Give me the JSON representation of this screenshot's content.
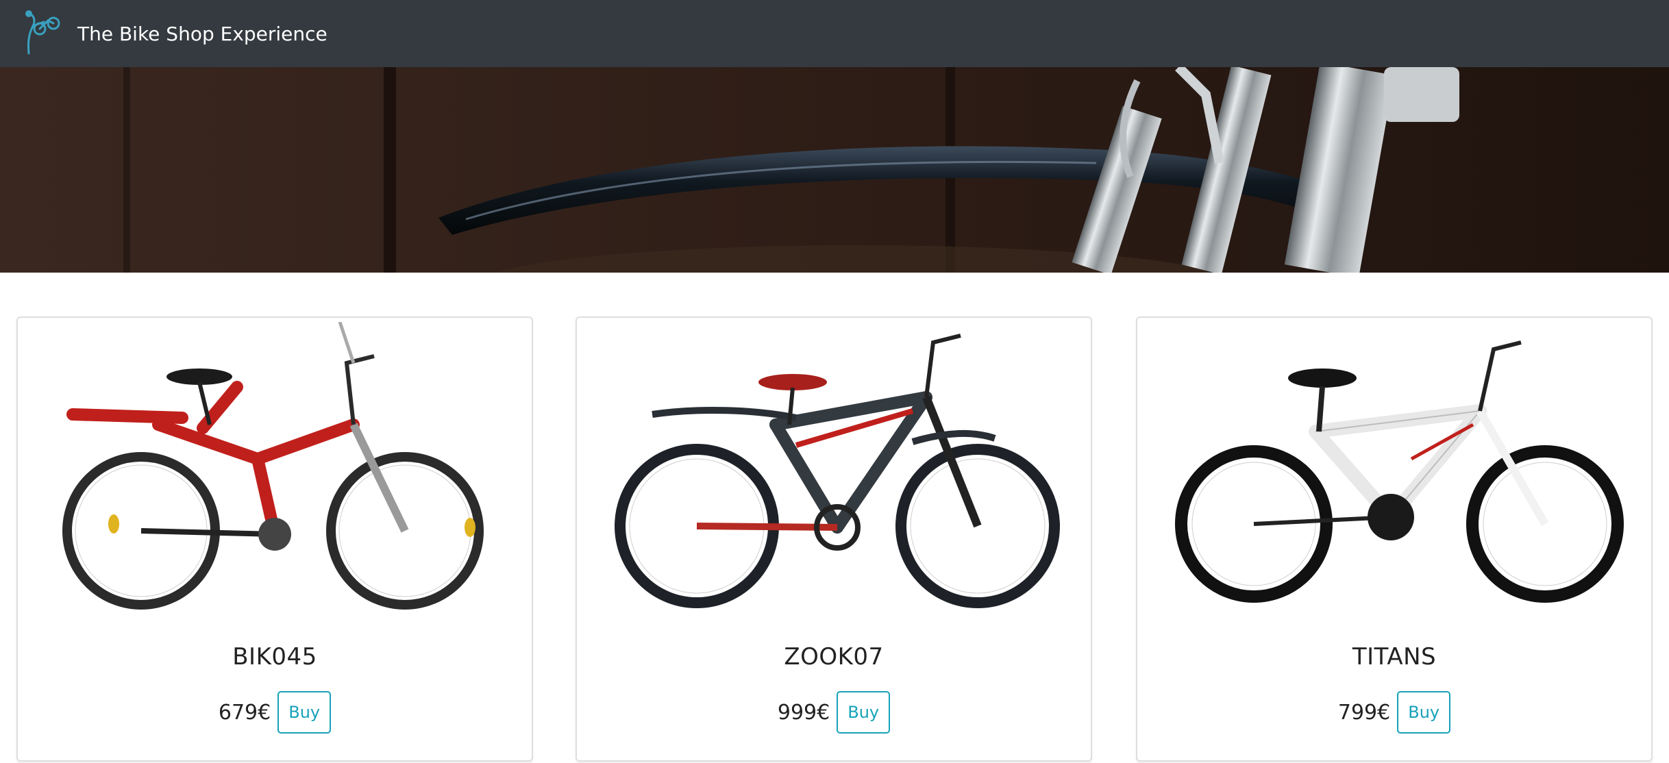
{
  "navbar": {
    "brand_title": "The Bike Shop Experience",
    "logo_icon": "cyclist-logo-icon",
    "background_color": "#343a40",
    "accent_color": "#3aa1c0"
  },
  "hero": {
    "image": "bike-fender-photo"
  },
  "products": [
    {
      "name": "BIK045",
      "price": "679€",
      "buy_label": "Buy",
      "frame_color": "#c0201c"
    },
    {
      "name": "ZOOK07",
      "price": "999€",
      "buy_label": "Buy",
      "frame_color": "#333a40"
    },
    {
      "name": "TITANS",
      "price": "799€",
      "buy_label": "Buy",
      "frame_color": "#f4f4f4"
    }
  ],
  "colors": {
    "buy_button": "#17a2b8",
    "card_border": "#dedede"
  }
}
